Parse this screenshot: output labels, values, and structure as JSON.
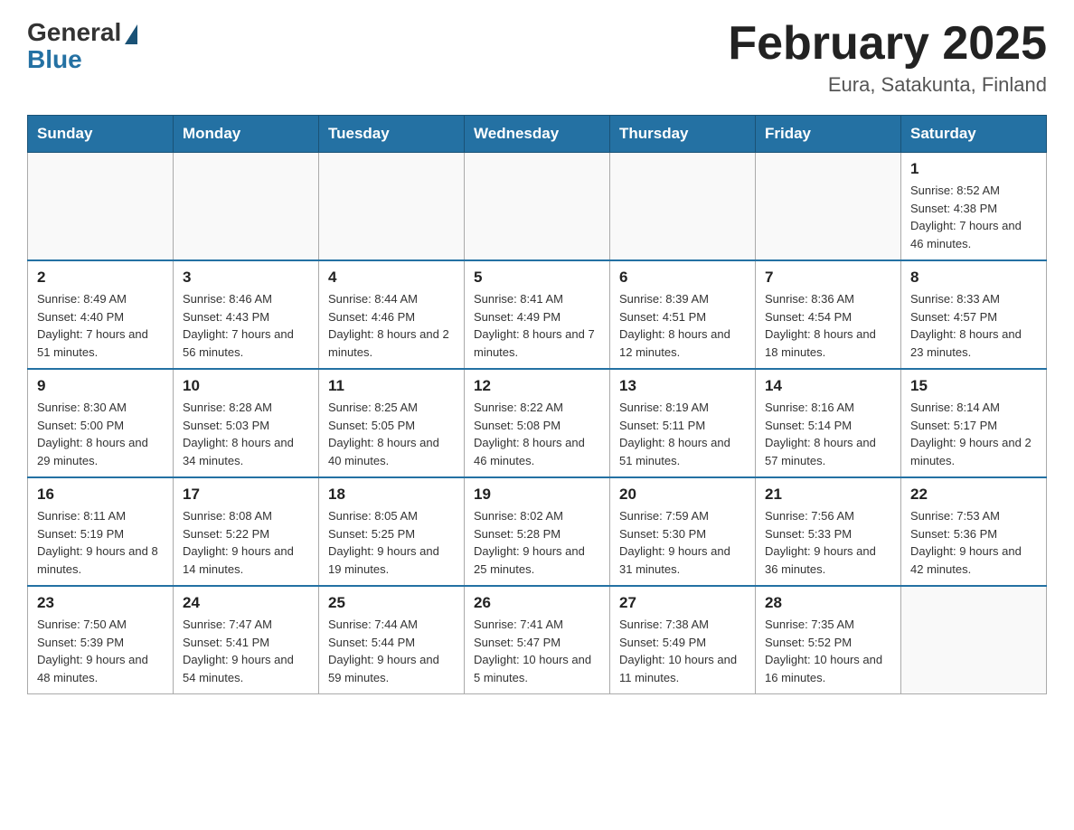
{
  "header": {
    "logo_general": "General",
    "logo_blue": "Blue",
    "month_title": "February 2025",
    "location": "Eura, Satakunta, Finland"
  },
  "days_of_week": [
    "Sunday",
    "Monday",
    "Tuesday",
    "Wednesday",
    "Thursday",
    "Friday",
    "Saturday"
  ],
  "weeks": [
    [
      {
        "day": "",
        "info": ""
      },
      {
        "day": "",
        "info": ""
      },
      {
        "day": "",
        "info": ""
      },
      {
        "day": "",
        "info": ""
      },
      {
        "day": "",
        "info": ""
      },
      {
        "day": "",
        "info": ""
      },
      {
        "day": "1",
        "info": "Sunrise: 8:52 AM\nSunset: 4:38 PM\nDaylight: 7 hours and 46 minutes."
      }
    ],
    [
      {
        "day": "2",
        "info": "Sunrise: 8:49 AM\nSunset: 4:40 PM\nDaylight: 7 hours and 51 minutes."
      },
      {
        "day": "3",
        "info": "Sunrise: 8:46 AM\nSunset: 4:43 PM\nDaylight: 7 hours and 56 minutes."
      },
      {
        "day": "4",
        "info": "Sunrise: 8:44 AM\nSunset: 4:46 PM\nDaylight: 8 hours and 2 minutes."
      },
      {
        "day": "5",
        "info": "Sunrise: 8:41 AM\nSunset: 4:49 PM\nDaylight: 8 hours and 7 minutes."
      },
      {
        "day": "6",
        "info": "Sunrise: 8:39 AM\nSunset: 4:51 PM\nDaylight: 8 hours and 12 minutes."
      },
      {
        "day": "7",
        "info": "Sunrise: 8:36 AM\nSunset: 4:54 PM\nDaylight: 8 hours and 18 minutes."
      },
      {
        "day": "8",
        "info": "Sunrise: 8:33 AM\nSunset: 4:57 PM\nDaylight: 8 hours and 23 minutes."
      }
    ],
    [
      {
        "day": "9",
        "info": "Sunrise: 8:30 AM\nSunset: 5:00 PM\nDaylight: 8 hours and 29 minutes."
      },
      {
        "day": "10",
        "info": "Sunrise: 8:28 AM\nSunset: 5:03 PM\nDaylight: 8 hours and 34 minutes."
      },
      {
        "day": "11",
        "info": "Sunrise: 8:25 AM\nSunset: 5:05 PM\nDaylight: 8 hours and 40 minutes."
      },
      {
        "day": "12",
        "info": "Sunrise: 8:22 AM\nSunset: 5:08 PM\nDaylight: 8 hours and 46 minutes."
      },
      {
        "day": "13",
        "info": "Sunrise: 8:19 AM\nSunset: 5:11 PM\nDaylight: 8 hours and 51 minutes."
      },
      {
        "day": "14",
        "info": "Sunrise: 8:16 AM\nSunset: 5:14 PM\nDaylight: 8 hours and 57 minutes."
      },
      {
        "day": "15",
        "info": "Sunrise: 8:14 AM\nSunset: 5:17 PM\nDaylight: 9 hours and 2 minutes."
      }
    ],
    [
      {
        "day": "16",
        "info": "Sunrise: 8:11 AM\nSunset: 5:19 PM\nDaylight: 9 hours and 8 minutes."
      },
      {
        "day": "17",
        "info": "Sunrise: 8:08 AM\nSunset: 5:22 PM\nDaylight: 9 hours and 14 minutes."
      },
      {
        "day": "18",
        "info": "Sunrise: 8:05 AM\nSunset: 5:25 PM\nDaylight: 9 hours and 19 minutes."
      },
      {
        "day": "19",
        "info": "Sunrise: 8:02 AM\nSunset: 5:28 PM\nDaylight: 9 hours and 25 minutes."
      },
      {
        "day": "20",
        "info": "Sunrise: 7:59 AM\nSunset: 5:30 PM\nDaylight: 9 hours and 31 minutes."
      },
      {
        "day": "21",
        "info": "Sunrise: 7:56 AM\nSunset: 5:33 PM\nDaylight: 9 hours and 36 minutes."
      },
      {
        "day": "22",
        "info": "Sunrise: 7:53 AM\nSunset: 5:36 PM\nDaylight: 9 hours and 42 minutes."
      }
    ],
    [
      {
        "day": "23",
        "info": "Sunrise: 7:50 AM\nSunset: 5:39 PM\nDaylight: 9 hours and 48 minutes."
      },
      {
        "day": "24",
        "info": "Sunrise: 7:47 AM\nSunset: 5:41 PM\nDaylight: 9 hours and 54 minutes."
      },
      {
        "day": "25",
        "info": "Sunrise: 7:44 AM\nSunset: 5:44 PM\nDaylight: 9 hours and 59 minutes."
      },
      {
        "day": "26",
        "info": "Sunrise: 7:41 AM\nSunset: 5:47 PM\nDaylight: 10 hours and 5 minutes."
      },
      {
        "day": "27",
        "info": "Sunrise: 7:38 AM\nSunset: 5:49 PM\nDaylight: 10 hours and 11 minutes."
      },
      {
        "day": "28",
        "info": "Sunrise: 7:35 AM\nSunset: 5:52 PM\nDaylight: 10 hours and 16 minutes."
      },
      {
        "day": "",
        "info": ""
      }
    ]
  ]
}
